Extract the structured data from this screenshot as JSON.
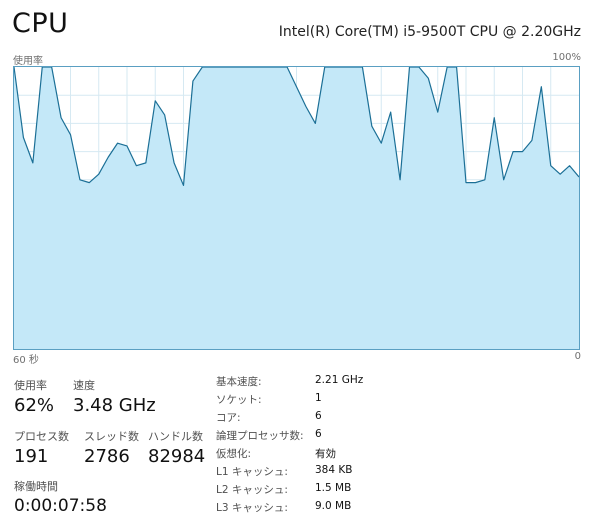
{
  "header": {
    "title": "CPU",
    "cpu_model": "Intel(R) Core(TM) i5-9500T CPU @ 2.20GHz"
  },
  "graph": {
    "usage_label": "使用率",
    "max_label": "100%",
    "time_label": "60 秒",
    "zero_label": "0",
    "fill_color": "#c4e8f8",
    "line_color": "#1b6f96",
    "grid_color": "#d6e9f2",
    "usage_percent_history": [
      100,
      75,
      66,
      100,
      100,
      82,
      76,
      60,
      59,
      62,
      68,
      73,
      72,
      65,
      66,
      88,
      83,
      66,
      58,
      95,
      100,
      100,
      100,
      100,
      100,
      100,
      100,
      100,
      100,
      100,
      93,
      86,
      80,
      100,
      100,
      100,
      100,
      100,
      79,
      73,
      84,
      60,
      100,
      100,
      96,
      84,
      100,
      100,
      59,
      59,
      60,
      82,
      60,
      70,
      70,
      74,
      93,
      65,
      62,
      65,
      61
    ]
  },
  "stats": {
    "usage": {
      "label": "使用率",
      "value": "62%"
    },
    "speed": {
      "label": "速度",
      "value": "3.48 GHz"
    },
    "processes": {
      "label": "プロセス数",
      "value": "191"
    },
    "threads": {
      "label": "スレッド数",
      "value": "2786"
    },
    "handles": {
      "label": "ハンドル数",
      "value": "82984"
    },
    "uptime": {
      "label": "稼働時間",
      "value": "0:00:07:58"
    }
  },
  "details": [
    {
      "key": "基本速度:",
      "value": "2.21 GHz"
    },
    {
      "key": "ソケット:",
      "value": "1"
    },
    {
      "key": "コア:",
      "value": "6"
    },
    {
      "key": "論理プロセッサ数:",
      "value": "6"
    },
    {
      "key": "仮想化:",
      "value": "有効"
    },
    {
      "key": "L1 キャッシュ:",
      "value": "384 KB"
    },
    {
      "key": "L2 キャッシュ:",
      "value": "1.5 MB"
    },
    {
      "key": "L3 キャッシュ:",
      "value": "9.0 MB"
    }
  ]
}
